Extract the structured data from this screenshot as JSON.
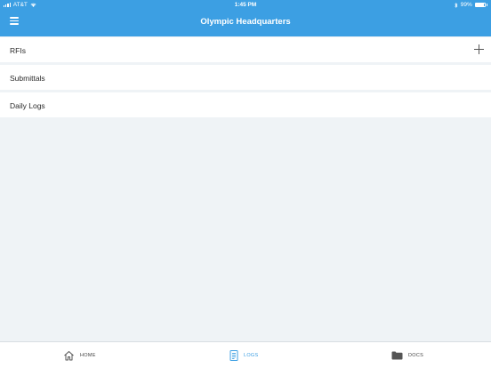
{
  "status_bar": {
    "carrier": "AT&T",
    "time": "1:45 PM",
    "battery": "99%"
  },
  "nav": {
    "title": "Olympic Headquarters",
    "menu_icon": "hamburger-menu-icon"
  },
  "list": {
    "items": [
      {
        "label": "RFIs",
        "action_icon": "plus-icon"
      },
      {
        "label": "Submittals"
      },
      {
        "label": "Daily Logs"
      }
    ]
  },
  "tabbar": {
    "tabs": [
      {
        "label": "HOME",
        "icon": "home-icon",
        "active": false
      },
      {
        "label": "LOGS",
        "icon": "document-icon",
        "active": true
      },
      {
        "label": "DOCS",
        "icon": "folder-icon",
        "active": false
      }
    ]
  },
  "colors": {
    "primary": "#3c9fe3",
    "background": "#eff3f6",
    "tab_inactive": "#444444"
  }
}
